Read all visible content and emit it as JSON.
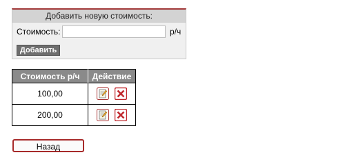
{
  "add_form": {
    "header": "Добавить новую стоимость:",
    "cost_label": "Стоимость:",
    "cost_value": "",
    "cost_placeholder": "",
    "unit": "р/ч",
    "submit_label": "Добавить"
  },
  "table": {
    "columns": [
      "Стоимость р/ч",
      "Действие"
    ],
    "rows": [
      {
        "cost": "100,00",
        "actions": [
          "edit-icon",
          "delete-icon"
        ]
      },
      {
        "cost": "200,00",
        "actions": [
          "edit-icon",
          "delete-icon"
        ]
      }
    ]
  },
  "back_label": "Назад",
  "colors": {
    "accent_red": "#a72a2a",
    "header_gray": "#8a8a8a",
    "panel_header": "#d3d3d3",
    "delete_red": "#c0282d"
  }
}
